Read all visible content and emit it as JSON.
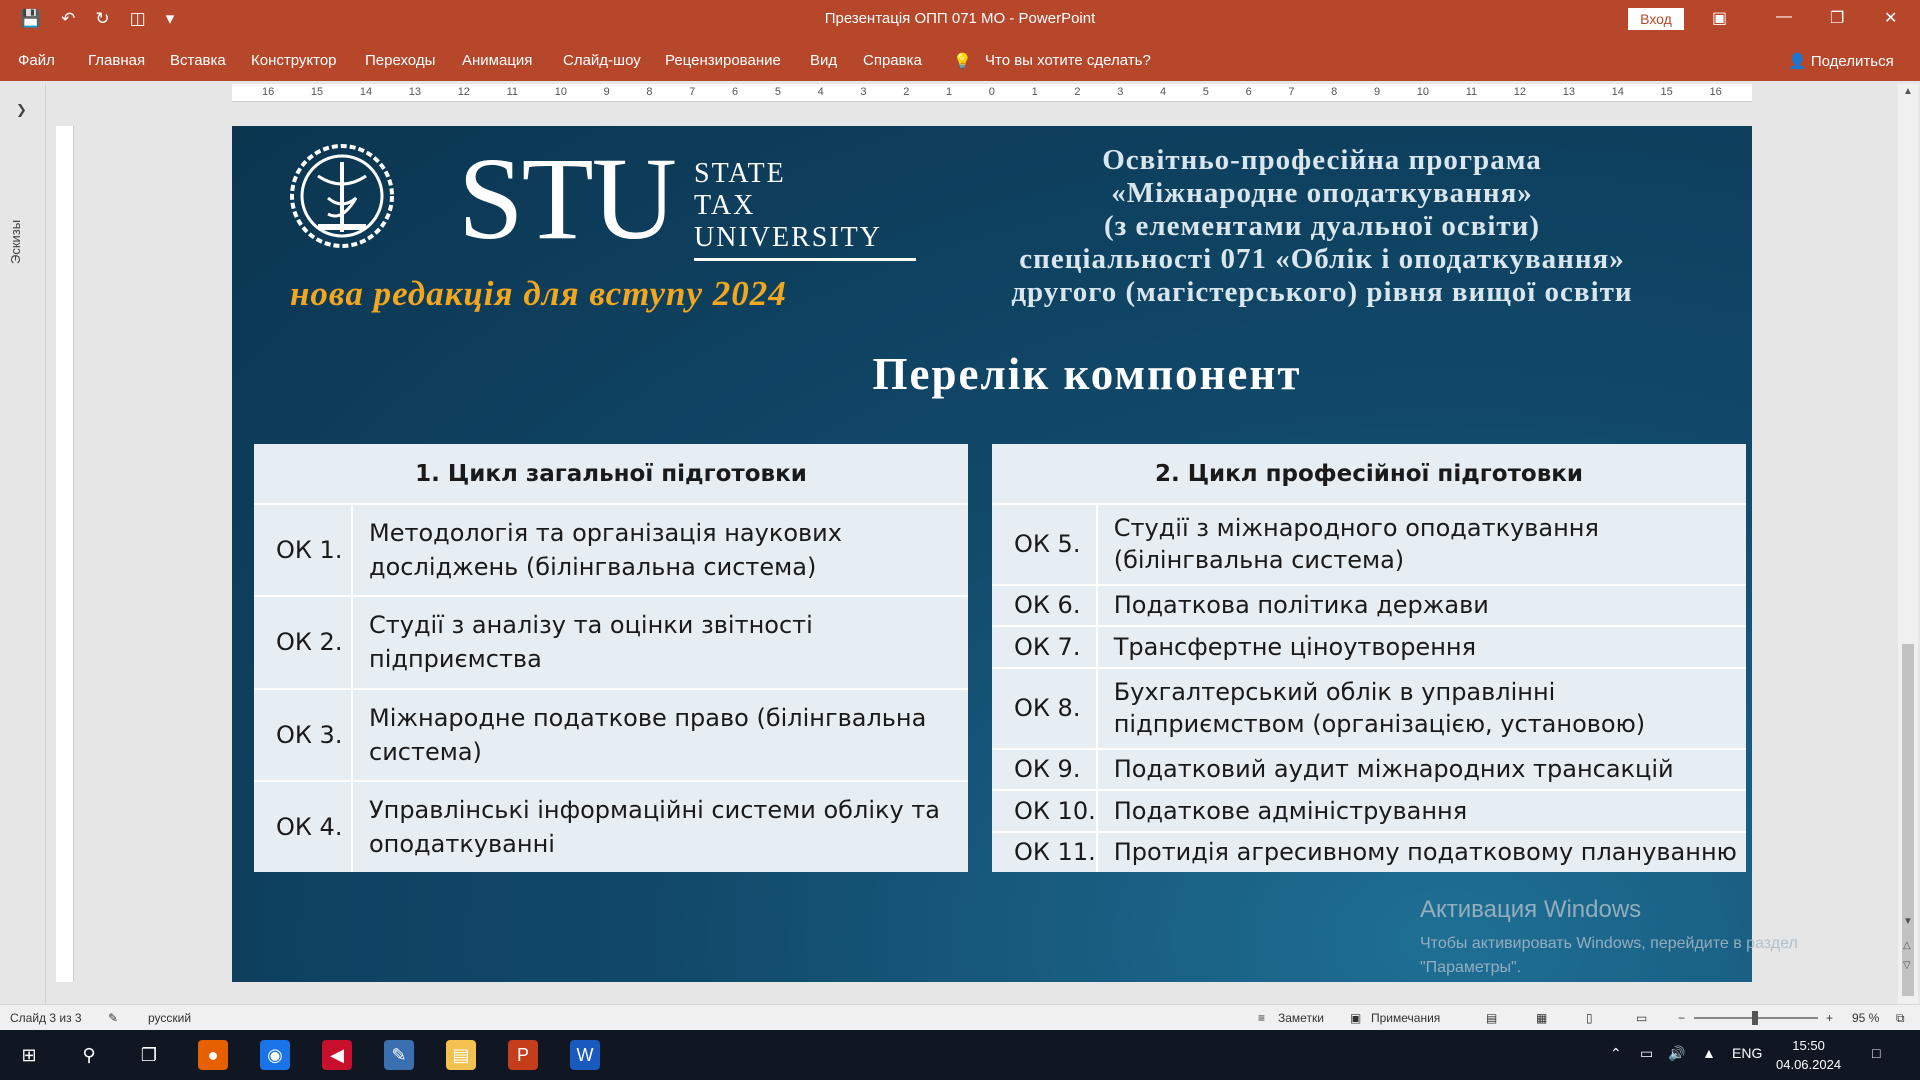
{
  "window": {
    "title": "Презентація ОПП 071 МО  -  PowerPoint",
    "signin": "Вход",
    "qat_icons": [
      "save-icon",
      "undo-icon",
      "redo-icon",
      "start-from-beginning-icon",
      "customize-icon"
    ]
  },
  "ribbon": {
    "tabs": [
      "Файл",
      "Главная",
      "Вставка",
      "Конструктор",
      "Переходы",
      "Анимация",
      "Слайд-шоу",
      "Рецензирование",
      "Вид",
      "Справка"
    ],
    "tell_me": "Что вы хотите сделать?",
    "share": "Поделиться"
  },
  "ruler": {
    "marks": [
      "16",
      "15",
      "14",
      "13",
      "12",
      "11",
      "10",
      "9",
      "8",
      "7",
      "6",
      "5",
      "4",
      "3",
      "2",
      "1",
      "0",
      "1",
      "2",
      "3",
      "4",
      "5",
      "6",
      "7",
      "8",
      "9",
      "10",
      "11",
      "12",
      "13",
      "14",
      "15",
      "16"
    ]
  },
  "left_pane": {
    "label": "Эскизы"
  },
  "slide": {
    "logo_letters": "STU",
    "logo_words": [
      "STATE",
      "TAX",
      "UNIVERSITY"
    ],
    "edition": "нова редакція для вступу 2024",
    "program_lines": [
      "Освітньо-професійна програма",
      "«Міжнародне оподаткування»",
      "(з елементами дуальної освіти)",
      "спеціальності 071 «Облік і оподаткування»",
      "другого (магістерського) рівня вищої освіти"
    ],
    "heading": "Перелік компонент",
    "table1": {
      "header": "1. Цикл загальної підготовки",
      "rows": [
        {
          "code": "ОК 1.",
          "name": "Методологія та організація наукових досліджень (білінгвальна система)"
        },
        {
          "code": "ОК 2.",
          "name": "Студії з аналізу та оцінки звітності підприємства"
        },
        {
          "code": "ОК 3.",
          "name": "Міжнародне податкове право (білінгвальна система)"
        },
        {
          "code": "ОК 4.",
          "name": "Управлінські інформаційні системи обліку та оподаткуванні"
        }
      ]
    },
    "table2": {
      "header": "2. Цикл професійної підготовки",
      "rows": [
        {
          "code": "ОК 5.",
          "name": "Студії з міжнародного оподаткування (білінгвальна система)"
        },
        {
          "code": "ОК 6.",
          "name": "Податкова політика держави"
        },
        {
          "code": "ОК 7.",
          "name": "Трансфертне ціноутворення"
        },
        {
          "code": "ОК 8.",
          "name": "Бухгалтерський облік в управлінні підприємством (організацією, установою)"
        },
        {
          "code": "ОК 9.",
          "name": "Податковий аудит міжнародних трансакцій"
        },
        {
          "code": "ОК 10.",
          "name": "Податкове адміністрування"
        },
        {
          "code": "ОК 11.",
          "name": "Протидія агресивному податковому плануванню"
        }
      ]
    },
    "activation": {
      "title": "Активация Windows",
      "text": "Чтобы активировать Windows, перейдите в раздел \"Параметры\"."
    }
  },
  "status": {
    "slide": "Слайд 3 из 3",
    "language": "русский",
    "notes": "Заметки",
    "comments": "Примечания",
    "zoom": "95 %"
  },
  "taskbar": {
    "lang": "ENG",
    "time": "15:50",
    "date": "04.06.2024"
  },
  "colors": {
    "accent": "#b7472a",
    "slide_bg": "#11496a",
    "edition": "#f2a71e"
  }
}
